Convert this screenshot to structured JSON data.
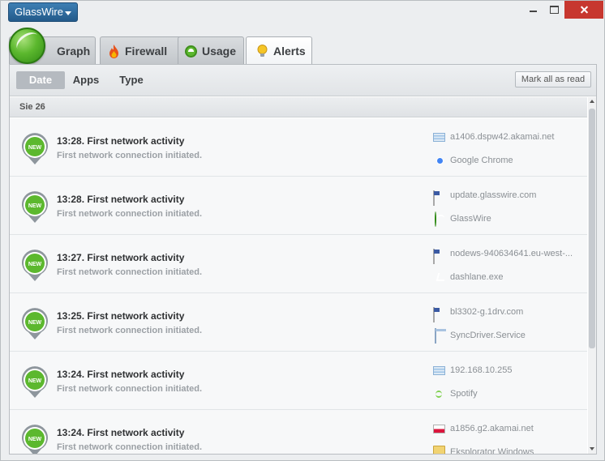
{
  "app": {
    "menu_label": "GlassWire"
  },
  "tabs": [
    {
      "label": "Graph",
      "icon": "glasswire-logo-icon"
    },
    {
      "label": "Firewall",
      "icon": "flame-icon"
    },
    {
      "label": "Usage",
      "icon": "usage-icon"
    },
    {
      "label": "Alerts",
      "icon": "lightbulb-icon",
      "active": true
    }
  ],
  "filters": {
    "items": [
      "Date",
      "Apps",
      "Type"
    ],
    "active": "Date",
    "mark_all_label": "Mark all as read"
  },
  "list": {
    "date_header": "Sie 26",
    "badge_text": "NEW",
    "rows": [
      {
        "title": "13:28. First network activity",
        "subtitle": "First network connection initiated.",
        "host": "a1406.dspw42.akamai.net",
        "host_icon": "network-icon",
        "app": "Google Chrome",
        "app_icon": "chrome-icon"
      },
      {
        "title": "13:28. First network activity",
        "subtitle": "First network connection initiated.",
        "host": "update.glasswire.com",
        "host_icon": "us-flag-icon",
        "app": "GlassWire",
        "app_icon": "glasswire-icon"
      },
      {
        "title": "13:27. First network activity",
        "subtitle": "First network connection initiated.",
        "host": "nodews-940634641.eu-west-...",
        "host_icon": "us-flag-icon",
        "app": "dashlane.exe",
        "app_icon": "dashlane-icon"
      },
      {
        "title": "13:25. First network activity",
        "subtitle": "First network connection initiated.",
        "host": "bl3302-g.1drv.com",
        "host_icon": "us-flag-icon",
        "app": "SyncDriver.Service",
        "app_icon": "window-icon"
      },
      {
        "title": "13:24. First network activity",
        "subtitle": "First network connection initiated.",
        "host": "192.168.10.255",
        "host_icon": "network-icon",
        "app": "Spotify",
        "app_icon": "spotify-icon"
      },
      {
        "title": "13:24. First network activity",
        "subtitle": "First network connection initiated.",
        "host": "a1856.g2.akamai.net",
        "host_icon": "pl-flag-icon",
        "app": "Eksplorator Windows",
        "app_icon": "folder-icon"
      }
    ]
  },
  "colors": {
    "accent_blue": "#2d6ea3",
    "badge_green": "#5cb82e",
    "close_red": "#c7372f"
  }
}
